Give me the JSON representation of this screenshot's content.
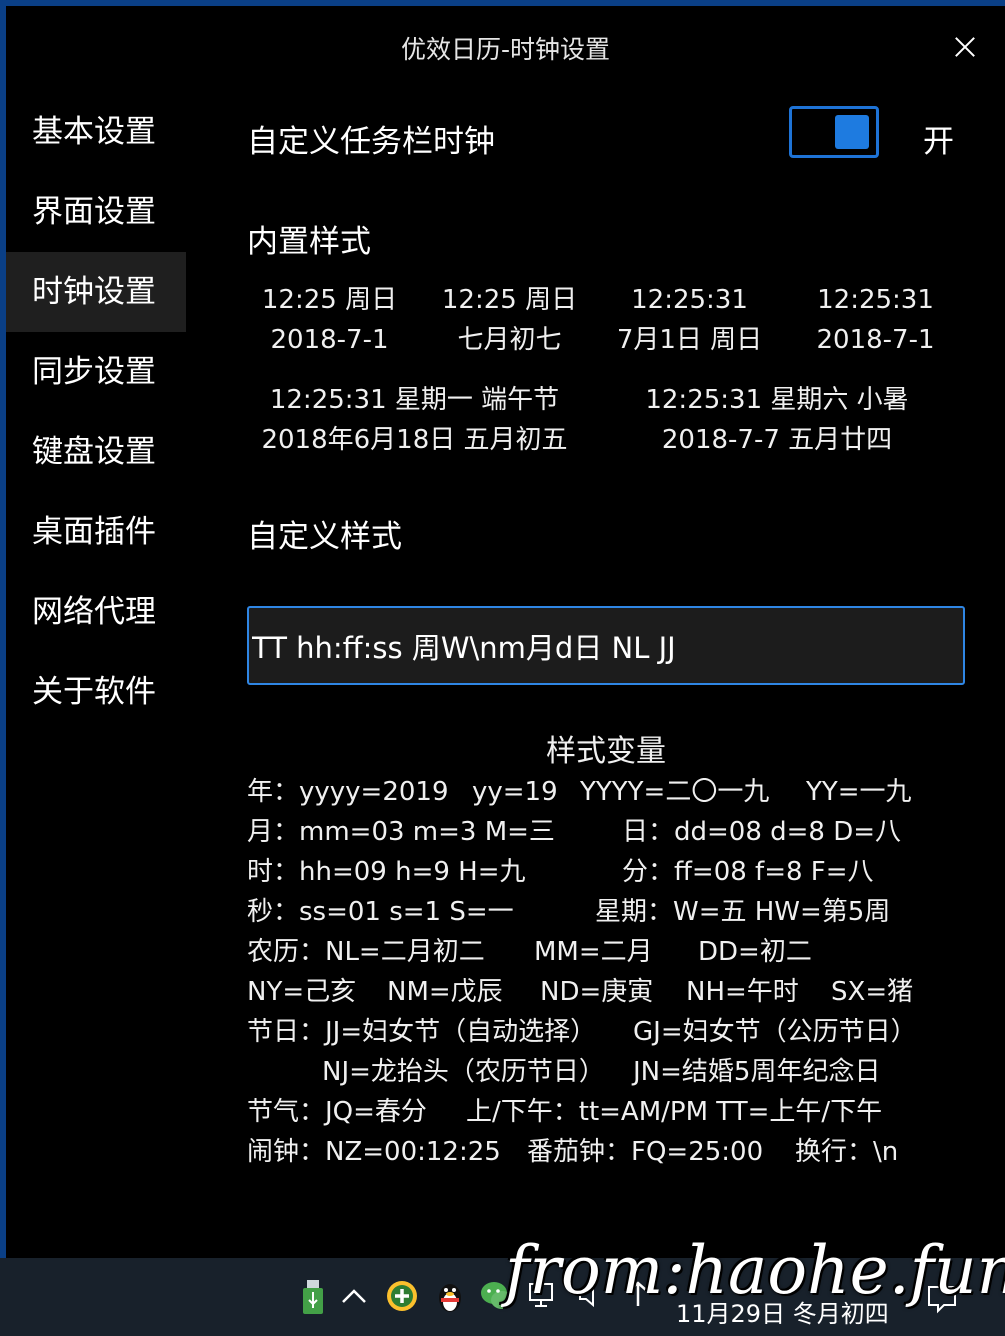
{
  "window": {
    "title": "优效日历-时钟设置"
  },
  "sidebar": {
    "items": [
      {
        "label": "基本设置"
      },
      {
        "label": "界面设置"
      },
      {
        "label": "时钟设置"
      },
      {
        "label": "同步设置"
      },
      {
        "label": "键盘设置"
      },
      {
        "label": "桌面插件"
      },
      {
        "label": "网络代理"
      },
      {
        "label": "关于软件"
      }
    ],
    "active": "时钟设置"
  },
  "main": {
    "custom_clock_label": "自定义任务栏时钟",
    "toggle_state": "开",
    "builtin_title": "内置样式",
    "presets": [
      {
        "line1": "12:25 周日",
        "line2": "2018-7-1"
      },
      {
        "line1": "12:25 周日",
        "line2": "七月初七"
      },
      {
        "line1": "12:25:31",
        "line2": "7月1日 周日"
      },
      {
        "line1": "12:25:31",
        "line2": "2018-7-1"
      },
      {
        "line1": "12:25:31 星期一 端午节",
        "line2": "2018年6月18日 五月初五"
      },
      {
        "line1": "12:25:31 星期六 小暑",
        "line2": "2018-7-7 五月廿四"
      }
    ],
    "custom_title": "自定义样式",
    "custom_value": "TT hh:ff:ss 周W\\nm月d日 NL JJ",
    "vars_title": "样式变量",
    "vars": [
      [
        "年：yyyy=2019",
        "yy=19",
        "YYYY=二〇一九",
        "YY=一九"
      ],
      [
        "月：mm=03 m=3 M=三",
        "日：dd=08 d=8 D=八"
      ],
      [
        "时：hh=09 h=9 H=九",
        "分：ff=08 f=8 F=八"
      ],
      [
        "秒：ss=01 s=1 S=一",
        "星期：W=五 HW=第5周"
      ],
      [
        "农历：NL=二月初二",
        "MM=二月",
        "DD=初二"
      ],
      [
        "NY=己亥",
        "NM=戊辰",
        "ND=庚寅",
        "NH=午时",
        "SX=猪"
      ],
      [
        "节日：JJ=妇女节（自动选择）",
        "GJ=妇女节（公历节日）"
      ],
      [
        "NJ=龙抬头（农历节日）",
        "JN=结婚5周年纪念日"
      ],
      [
        "节气：JQ=春分",
        "上/下午：tt=AM/PM TT=上午/下午"
      ],
      [
        "闹钟：NZ=00:12:25",
        "番茄钟：FQ=25:00",
        "换行：\\n"
      ]
    ]
  },
  "taskbar": {
    "date": "11月29日 冬月初四",
    "icons": [
      "usb-icon",
      "chevron-up-icon",
      "add-circle-icon",
      "qq-penguin-icon",
      "wechat-icon",
      "network-icon",
      "volume-icon",
      "pin-icon",
      "notification-icon"
    ]
  },
  "watermark": "from:haohe.fun",
  "colors": {
    "accent": "#1e73d6",
    "window_bg": "#000000",
    "active_nav": "#1f1f1f",
    "taskbar": "#18212b"
  }
}
